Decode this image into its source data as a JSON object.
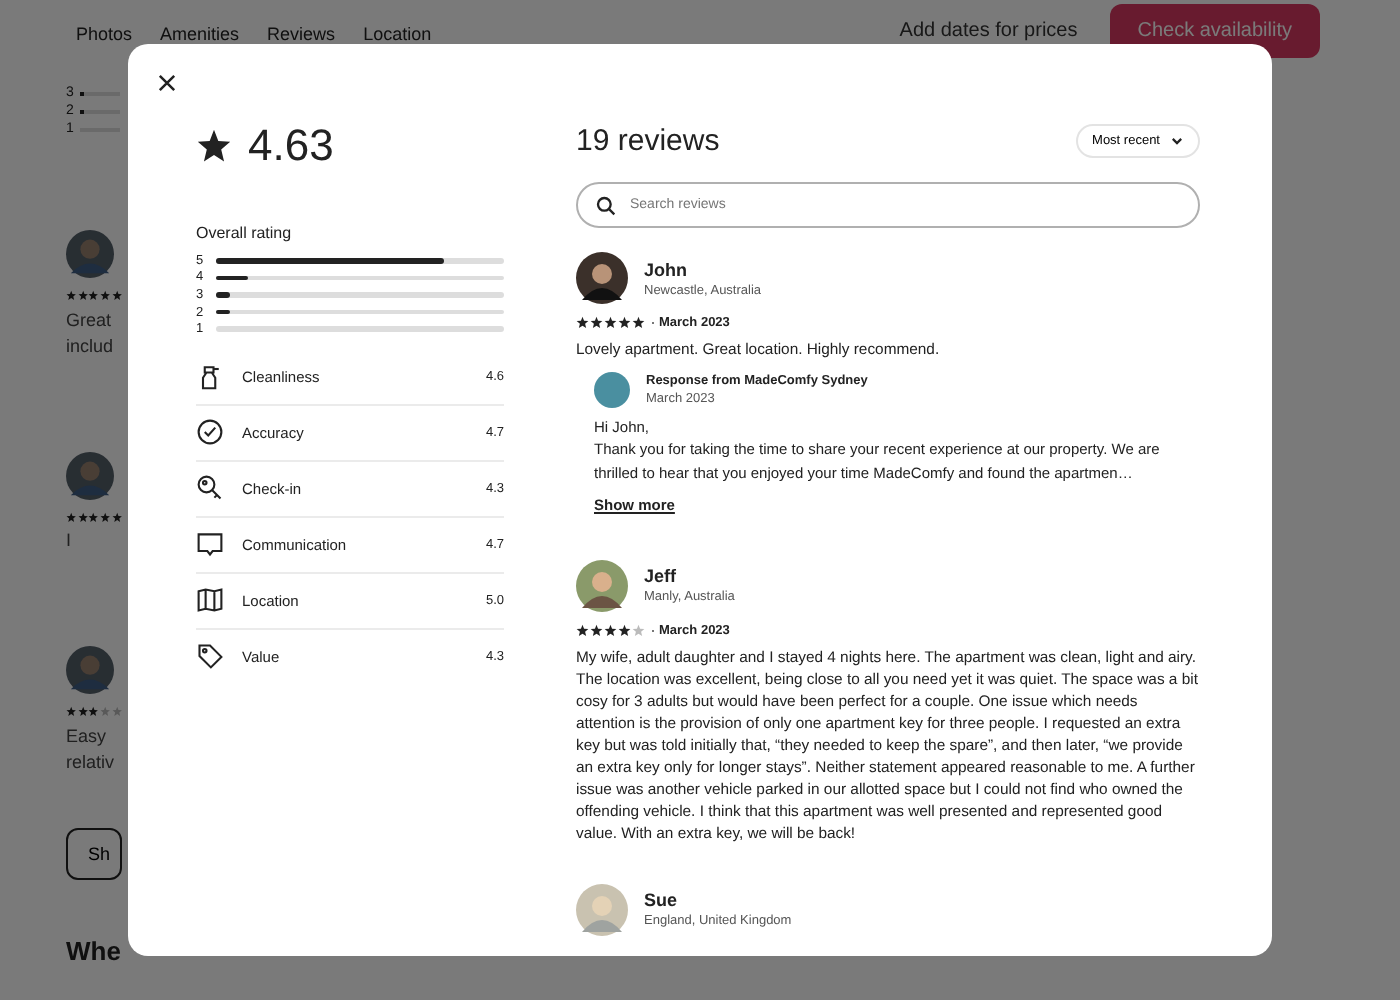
{
  "background": {
    "nav_tabs": [
      "Photos",
      "Amenities",
      "Reviews",
      "Location"
    ],
    "price_hint": "Add dates for prices",
    "cta": "Check availability",
    "rating_rows": [
      {
        "label": "3",
        "level": 0.1
      },
      {
        "label": "2",
        "level": 0.1
      },
      {
        "label": "1",
        "level": 0
      }
    ],
    "reviews": [
      {
        "stars": 5,
        "lines": [
          "Great",
          "includ"
        ]
      },
      {
        "stars": 5,
        "lines": [
          "I"
        ]
      },
      {
        "stars": 3,
        "lines": [
          "Easy",
          "relativ"
        ]
      }
    ],
    "button": "Sh",
    "heading": "Whe"
  },
  "modal": {
    "rating": "4.63",
    "reviews_count": "19 reviews",
    "sort": "Most recent",
    "search": {
      "placeholder": "Search reviews"
    },
    "overall": {
      "title": "Overall rating",
      "rows": [
        {
          "label": "5",
          "level": 0.79
        },
        {
          "label": "4",
          "level": 0.11
        },
        {
          "label": "3",
          "level": 0.05
        },
        {
          "label": "2",
          "level": 0.05
        },
        {
          "label": "1",
          "level": 0
        }
      ]
    },
    "categories": [
      {
        "kind": "cleanliness",
        "label": "Cleanliness",
        "score": "4.6"
      },
      {
        "kind": "accuracy",
        "label": "Accuracy",
        "score": "4.7"
      },
      {
        "kind": "checkin",
        "label": "Check-in",
        "score": "4.3"
      },
      {
        "kind": "communication",
        "label": "Communication",
        "score": "4.7"
      },
      {
        "kind": "location",
        "label": "Location",
        "score": "5.0"
      },
      {
        "kind": "value",
        "label": "Value",
        "score": "4.3"
      }
    ],
    "reviews": [
      {
        "name": "John",
        "location": "Newcastle, Australia",
        "stars": 5,
        "date": "March 2023",
        "text": "Lovely apartment. Great location. Highly recommend.",
        "response": {
          "from": "Response from MadeComfy Sydney",
          "date": "March 2023",
          "greeting": "Hi John,",
          "text": "Thank you for taking the time to share your recent experience at our property. We are thrilled to hear that you enjoyed your time MadeComfy and found the apartmen…",
          "more": "Show more"
        }
      },
      {
        "name": "Jeff",
        "location": "Manly, Australia",
        "stars": 4,
        "date": "March 2023",
        "text": "My wife, adult daughter and I stayed 4 nights here. The apartment was clean, light and airy. The location was excellent, being close to all you need yet it was quiet. The space was a bit cosy for 3 adults but would have been perfect for a couple. One issue which needs attention is the provision of only one apartment key for three people. I requested an extra key but was told initially that, “they needed to keep the spare”, and then later, “we provide an extra key only for longer stays”. Neither statement appeared reasonable to me. A further issue was another vehicle parked in our allotted space but I could not find who owned the offending vehicle. I think that this apartment was well presented and represented good value. With an extra key, we will be back!"
      },
      {
        "name": "Sue",
        "location": "England, United Kingdom"
      }
    ]
  }
}
